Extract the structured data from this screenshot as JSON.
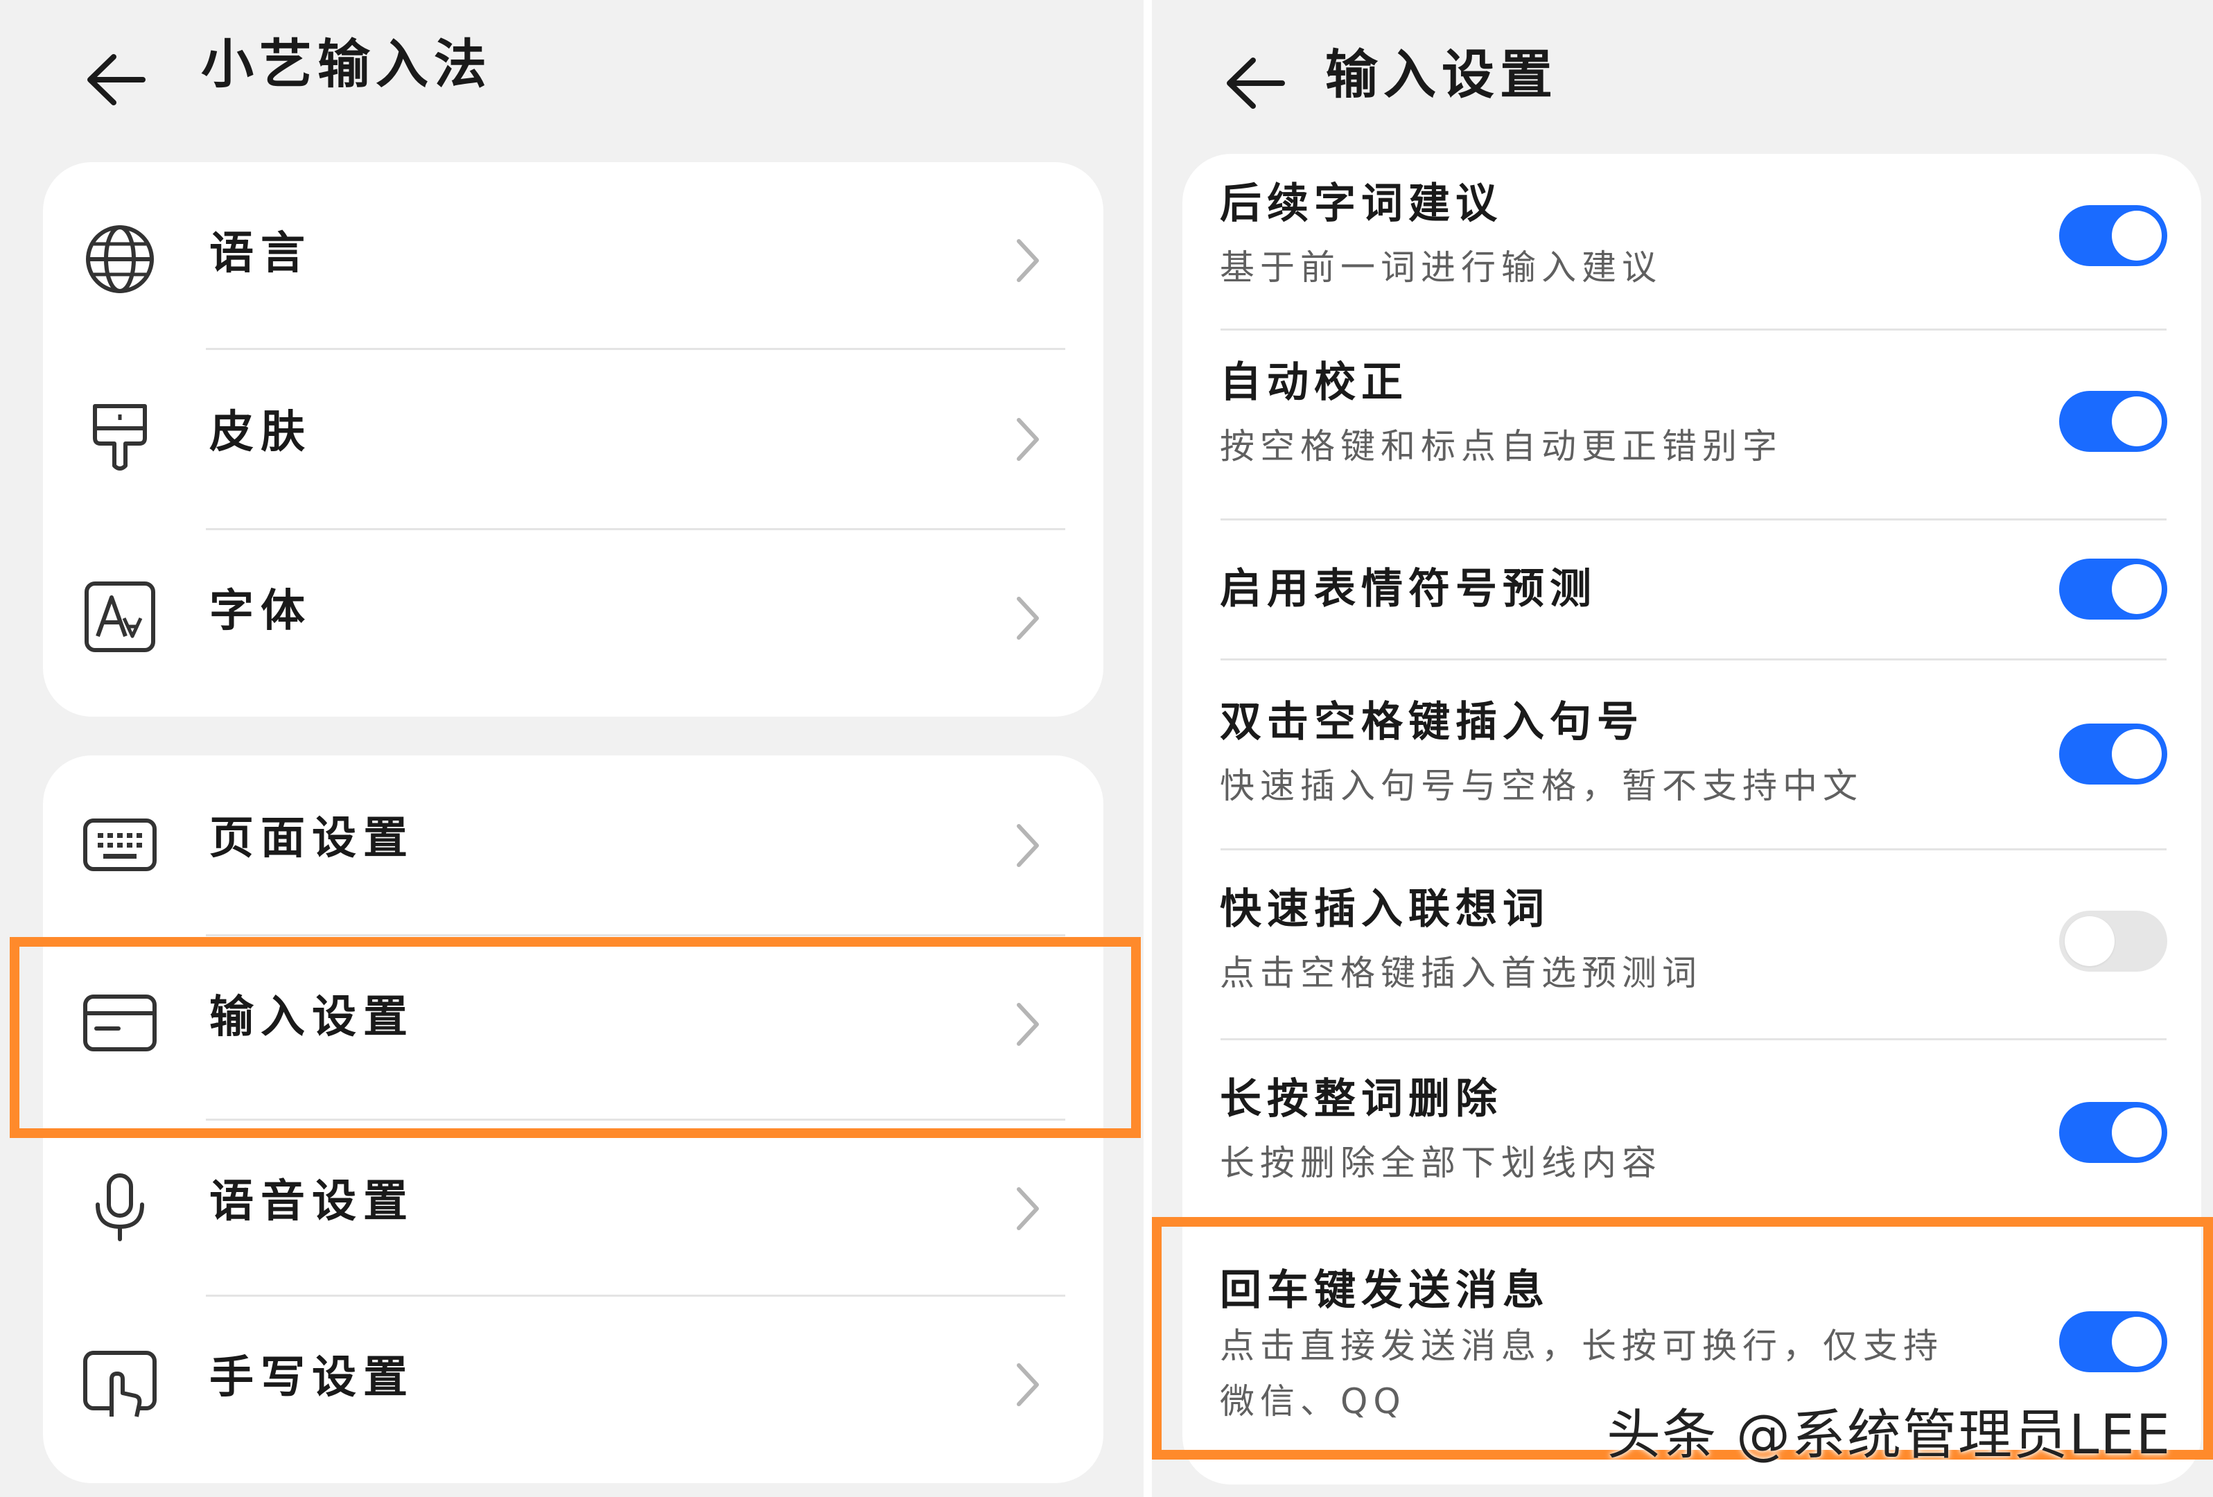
{
  "left": {
    "title": "小艺输入法",
    "group1": [
      {
        "label": "语言",
        "icon": "globe-icon"
      },
      {
        "label": "皮肤",
        "icon": "paint-brush-icon"
      },
      {
        "label": "字体",
        "icon": "font-icon"
      }
    ],
    "group2": [
      {
        "label": "页面设置",
        "icon": "keyboard-icon"
      },
      {
        "label": "输入设置",
        "icon": "input-card-icon"
      },
      {
        "label": "语音设置",
        "icon": "microphone-icon"
      },
      {
        "label": "手写设置",
        "icon": "handwriting-icon"
      }
    ]
  },
  "right": {
    "title": "输入设置",
    "settings": [
      {
        "title": "后续字词建议",
        "desc": "基于前一词进行输入建议",
        "enabled": true
      },
      {
        "title": "自动校正",
        "desc": "按空格键和标点自动更正错别字",
        "enabled": true
      },
      {
        "title": "启用表情符号预测",
        "desc": "",
        "enabled": true
      },
      {
        "title": "双击空格键插入句号",
        "desc": "快速插入句号与空格，暂不支持中文",
        "enabled": true
      },
      {
        "title": "快速插入联想词",
        "desc": "点击空格键插入首选预测词",
        "enabled": false
      },
      {
        "title": "长按整词删除",
        "desc": "长按删除全部下划线内容",
        "enabled": true
      },
      {
        "title": "回车键发送消息",
        "desc": "点击直接发送消息，长按可换行，仅支持微信、QQ",
        "enabled": true
      }
    ]
  },
  "watermark": "头条 @系统管理员LEE",
  "colors": {
    "accent": "#1a6bff",
    "highlight": "#ff8a2b",
    "background": "#f1f1f1"
  }
}
